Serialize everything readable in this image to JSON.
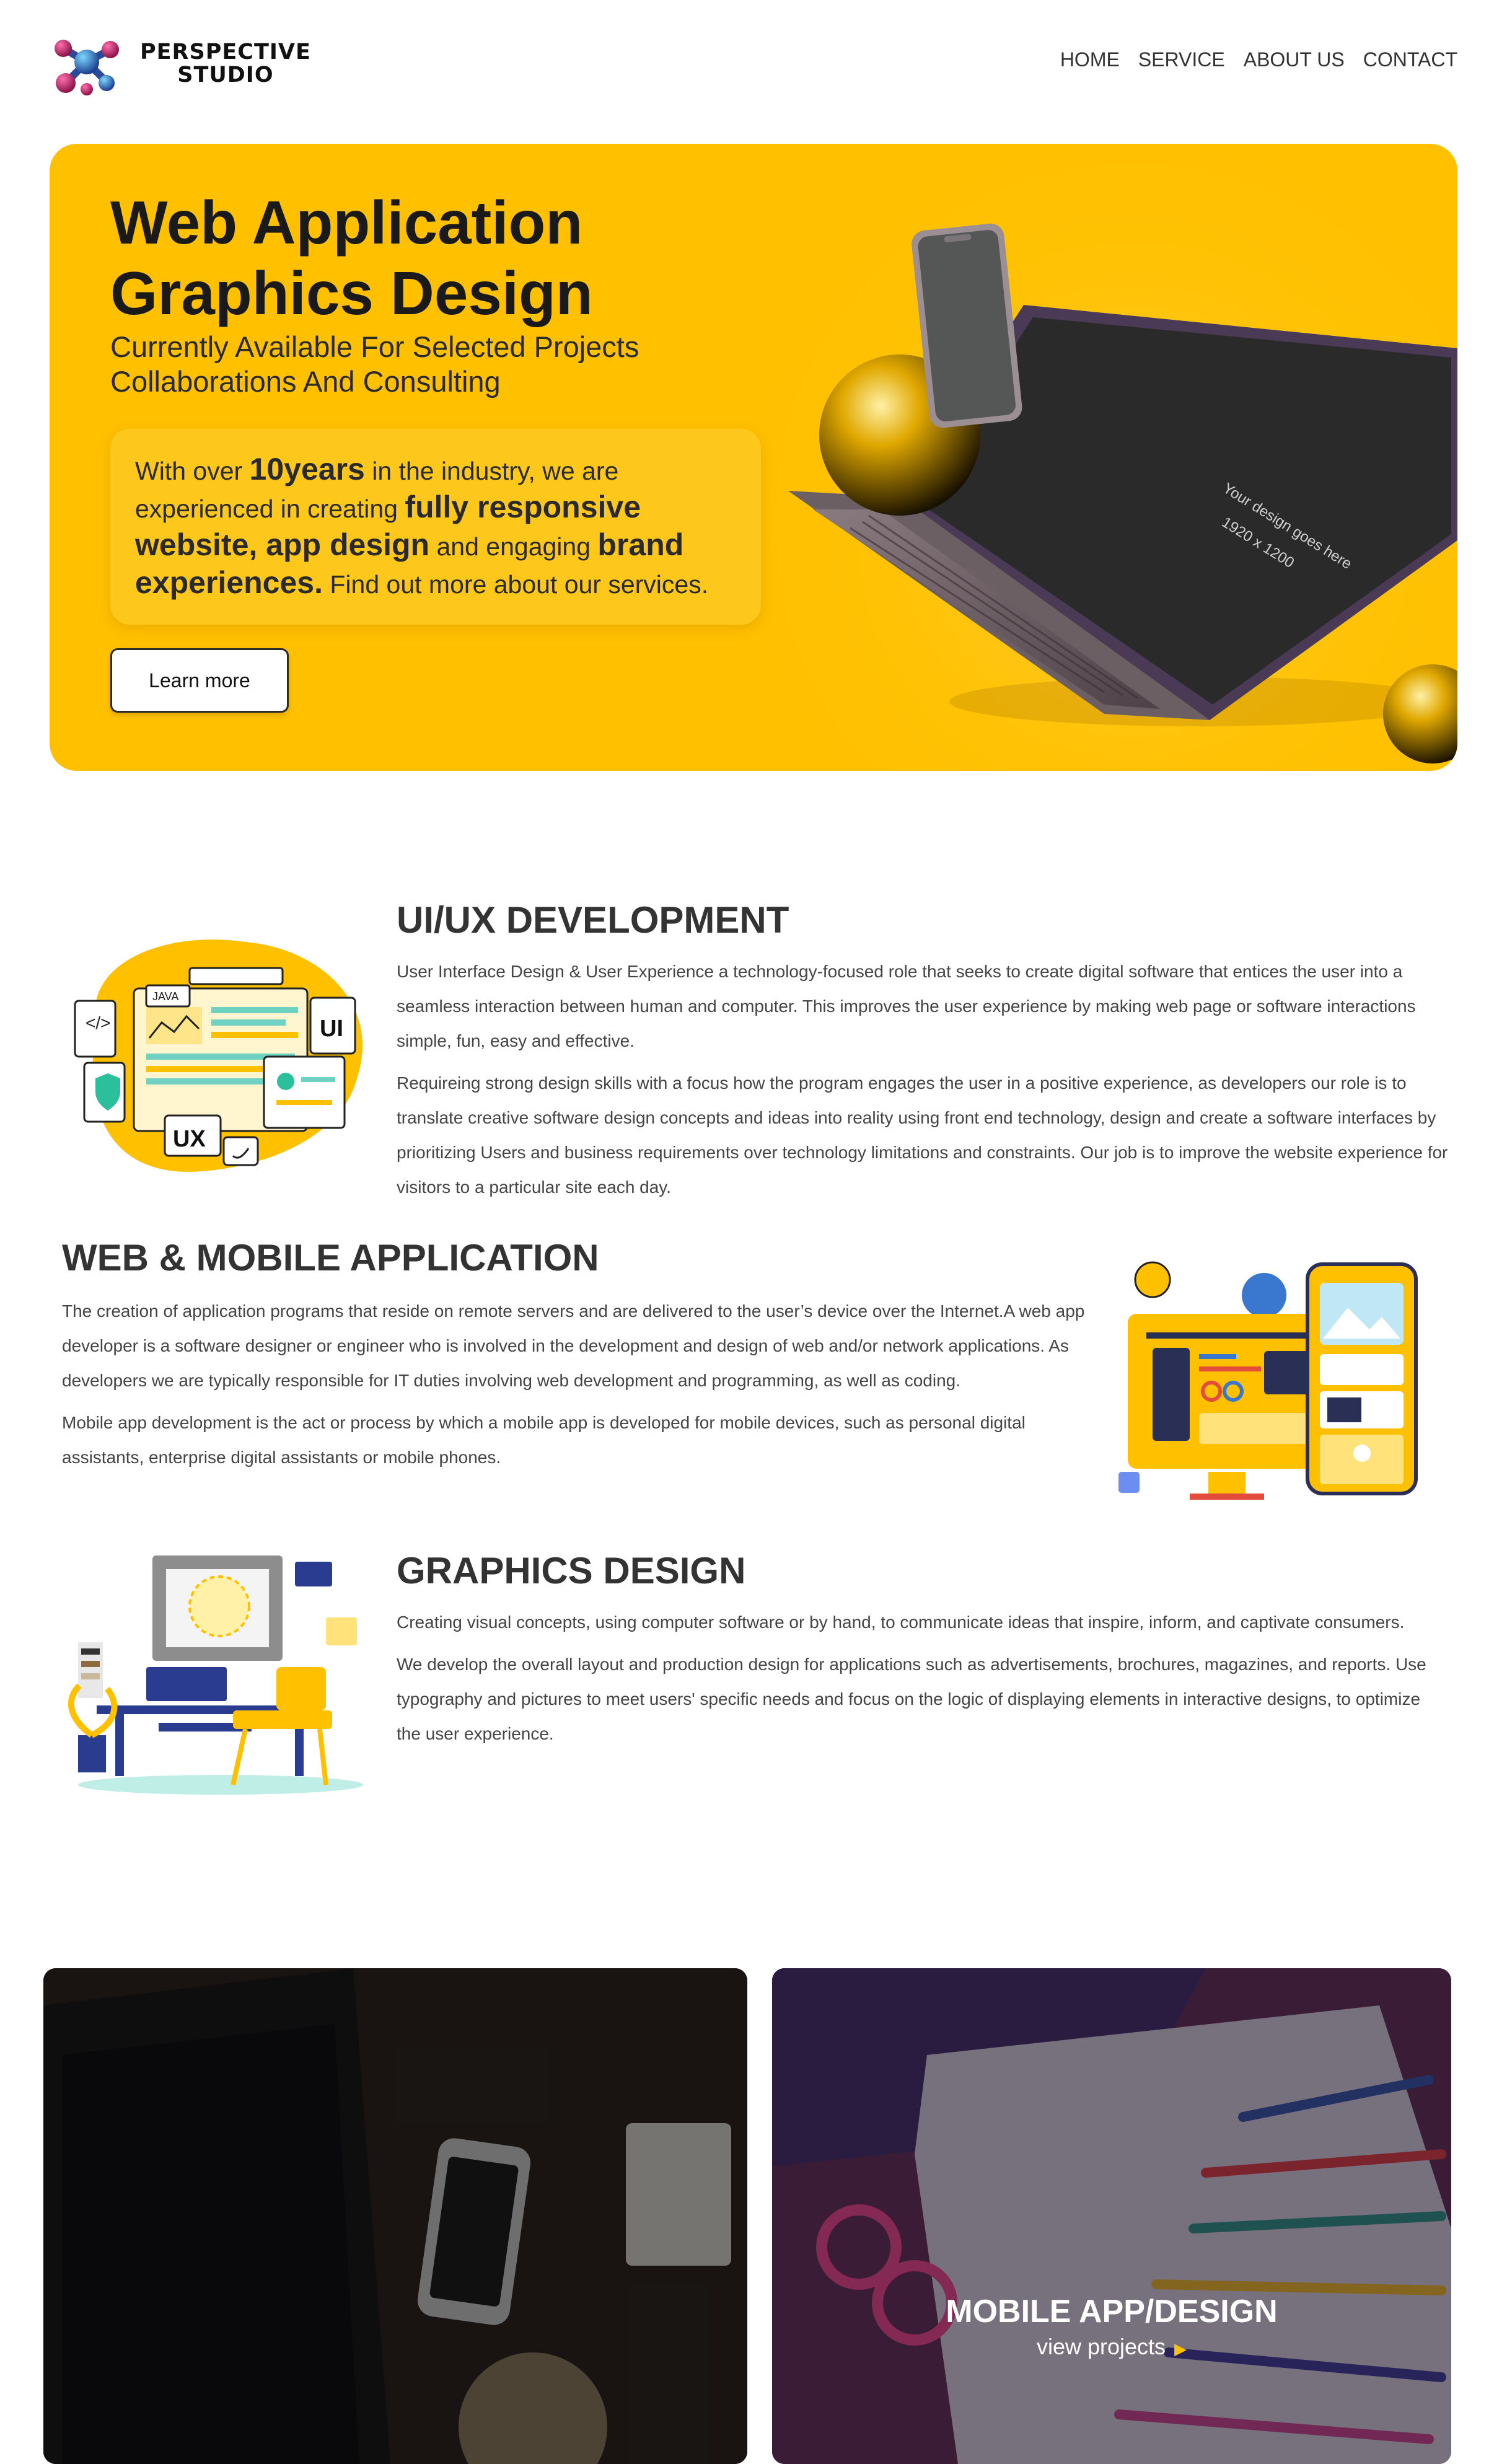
{
  "brand": {
    "line1": "PERSPECTIVE",
    "line2": "STUDIO"
  },
  "nav": [
    "HOME",
    "SERVICE",
    "ABOUT US",
    "CONTACT"
  ],
  "hero": {
    "title_line1": "Web Application",
    "title_line2": "Graphics Design",
    "subtitle_line1": "Currently Available For Selected Projects",
    "subtitle_line2": "Collaborations And Consulting",
    "card": {
      "t1": "With over ",
      "b1": "10years",
      "t2": " in the industry, we are experienced in creating ",
      "b2": "fully responsive website, app design",
      "t3": " and engaging ",
      "b3": "brand experiences.",
      "t4": " Find out more about our services."
    },
    "button": "Learn more",
    "mockup_laptop_text1": "Your design goes here",
    "mockup_laptop_text2": "1920 x 1200"
  },
  "sections": {
    "uiux": {
      "title": "UI/UX DEVELOPMENT",
      "p1": "User Interface Design & User Experience a technology-focused role that seeks to create digital software that entices the user into a seamless interaction between human and computer. This improves the user experience by making web page or software interactions simple, fun, easy and effective.",
      "p2": "Requireing strong design skills with a focus how the program engages the user in a positive experience, as developers our role is to translate creative software design concepts and ideas into reality using front end technology, design and create a software interfaces by prioritizing Users and business requirements over technology limitations and constraints. Our job is to improve the website experience for visitors to a particular site each day.",
      "illus_labels": [
        "JAVA",
        "UI",
        "UX"
      ]
    },
    "webmobile": {
      "title": "WEB & MOBILE APPLICATION",
      "p1": "The creation of application programs that reside on remote servers and are delivered to the user’s device over the Internet.A web app developer is a software designer or engineer who is involved in the development and design of web and/or network applications. As developers we are typically responsible for IT duties involving web development and programming, as well as coding.",
      "p2": "Mobile app development is the act or process by which a mobile app is developed for mobile devices, such as personal digital assistants, enterprise digital assistants or mobile phones."
    },
    "graphics": {
      "title": "GRAPHICS DESIGN",
      "p1": "Creating visual concepts, using computer software or by hand, to communicate ideas that inspire, inform, and captivate consumers.",
      "p2": "We develop the overall layout and production design for applications such as advertisements, brochures, magazines, and reports. Use typography and pictures to meet users' specific needs and focus on the logic of displaying elements in interactive designs, to optimize the user experience."
    }
  },
  "cards": {
    "right": {
      "title": "MOBILE APP/DESIGN",
      "link": "view projects"
    }
  },
  "colors": {
    "accent": "#ffc000",
    "text": "#333333"
  }
}
